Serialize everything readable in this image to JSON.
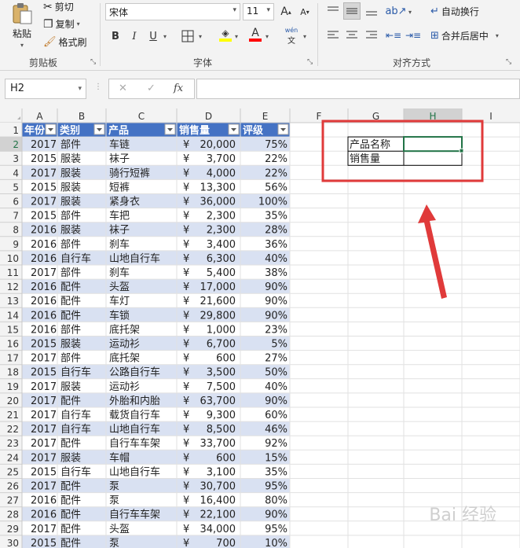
{
  "ribbon": {
    "clipboard": {
      "paste_label": "粘贴",
      "cut_label": "剪切",
      "copy_label": "复制",
      "format_painter_label": "格式刷",
      "group_label": "剪贴板"
    },
    "font": {
      "font_name": "宋体",
      "font_size": "11",
      "bold": "B",
      "italic": "I",
      "underline": "U",
      "font_color_glyph": "A",
      "grow": "A",
      "shrink": "A",
      "phonetic": "wén",
      "group_label": "字体",
      "colors": {
        "highlight": "#ffff00",
        "font": "#ff0000"
      }
    },
    "alignment": {
      "wrap_text_label": "自动换行",
      "merge_center_label": "合并后居中",
      "group_label": "对齐方式"
    }
  },
  "formula_bar": {
    "name_box": "H2",
    "cancel": "✕",
    "enter": "✓",
    "fx": "fx",
    "value": ""
  },
  "sheet": {
    "columns": [
      "A",
      "B",
      "C",
      "D",
      "E",
      "F",
      "G",
      "H",
      "I"
    ],
    "rows": [
      "1",
      "2",
      "3",
      "4",
      "5",
      "6",
      "7",
      "8",
      "9",
      "10",
      "11",
      "12",
      "13",
      "14",
      "15",
      "16",
      "17",
      "18",
      "19",
      "20",
      "21",
      "22",
      "23",
      "24",
      "25",
      "26",
      "27",
      "28",
      "29",
      "30"
    ],
    "table_headers": [
      "年份",
      "类别",
      "产品",
      "销售量",
      "评级"
    ],
    "table_rows": [
      [
        "2017",
        "部件",
        "车链",
        "¥",
        "20,000",
        "75%"
      ],
      [
        "2015",
        "服装",
        "袜子",
        "¥",
        "3,700",
        "22%"
      ],
      [
        "2017",
        "服装",
        "骑行短裤",
        "¥",
        "4,000",
        "22%"
      ],
      [
        "2015",
        "服装",
        "短裤",
        "¥",
        "13,300",
        "56%"
      ],
      [
        "2017",
        "服装",
        "紧身衣",
        "¥",
        "36,000",
        "100%"
      ],
      [
        "2015",
        "部件",
        "车把",
        "¥",
        "2,300",
        "35%"
      ],
      [
        "2016",
        "服装",
        "袜子",
        "¥",
        "2,300",
        "28%"
      ],
      [
        "2016",
        "部件",
        "刹车",
        "¥",
        "3,400",
        "36%"
      ],
      [
        "2016",
        "自行车",
        "山地自行车",
        "¥",
        "6,300",
        "40%"
      ],
      [
        "2017",
        "部件",
        "刹车",
        "¥",
        "5,400",
        "38%"
      ],
      [
        "2016",
        "配件",
        "头盔",
        "¥",
        "17,000",
        "90%"
      ],
      [
        "2016",
        "配件",
        "车灯",
        "¥",
        "21,600",
        "90%"
      ],
      [
        "2016",
        "配件",
        "车锁",
        "¥",
        "29,800",
        "90%"
      ],
      [
        "2016",
        "部件",
        "底托架",
        "¥",
        "1,000",
        "23%"
      ],
      [
        "2015",
        "服装",
        "运动衫",
        "¥",
        "6,700",
        "5%"
      ],
      [
        "2017",
        "部件",
        "底托架",
        "¥",
        "600",
        "27%"
      ],
      [
        "2015",
        "自行车",
        "公路自行车",
        "¥",
        "3,500",
        "50%"
      ],
      [
        "2017",
        "服装",
        "运动衫",
        "¥",
        "7,500",
        "40%"
      ],
      [
        "2017",
        "配件",
        "外胎和内胎",
        "¥",
        "63,700",
        "90%"
      ],
      [
        "2017",
        "自行车",
        "载货自行车",
        "¥",
        "9,300",
        "60%"
      ],
      [
        "2017",
        "自行车",
        "山地自行车",
        "¥",
        "8,500",
        "46%"
      ],
      [
        "2017",
        "配件",
        "自行车车架",
        "¥",
        "33,700",
        "92%"
      ],
      [
        "2017",
        "服装",
        "车帽",
        "¥",
        "600",
        "15%"
      ],
      [
        "2015",
        "自行车",
        "山地自行车",
        "¥",
        "3,100",
        "35%"
      ],
      [
        "2017",
        "配件",
        "泵",
        "¥",
        "30,700",
        "95%"
      ],
      [
        "2016",
        "配件",
        "泵",
        "¥",
        "16,400",
        "80%"
      ],
      [
        "2016",
        "配件",
        "自行车车架",
        "¥",
        "22,100",
        "90%"
      ],
      [
        "2017",
        "配件",
        "头盔",
        "¥",
        "34,000",
        "95%"
      ],
      [
        "2015",
        "配件",
        "泵",
        "¥",
        "700",
        "10%"
      ]
    ],
    "lookup": {
      "product_label": "产品名称",
      "sales_label": "销售量"
    },
    "colors": {
      "header_fill": "#4472c4",
      "band_fill": "#d9e1f2",
      "annotation_red": "#e03a3a",
      "selection_green": "#217346"
    }
  },
  "watermark": "Bai 经验"
}
